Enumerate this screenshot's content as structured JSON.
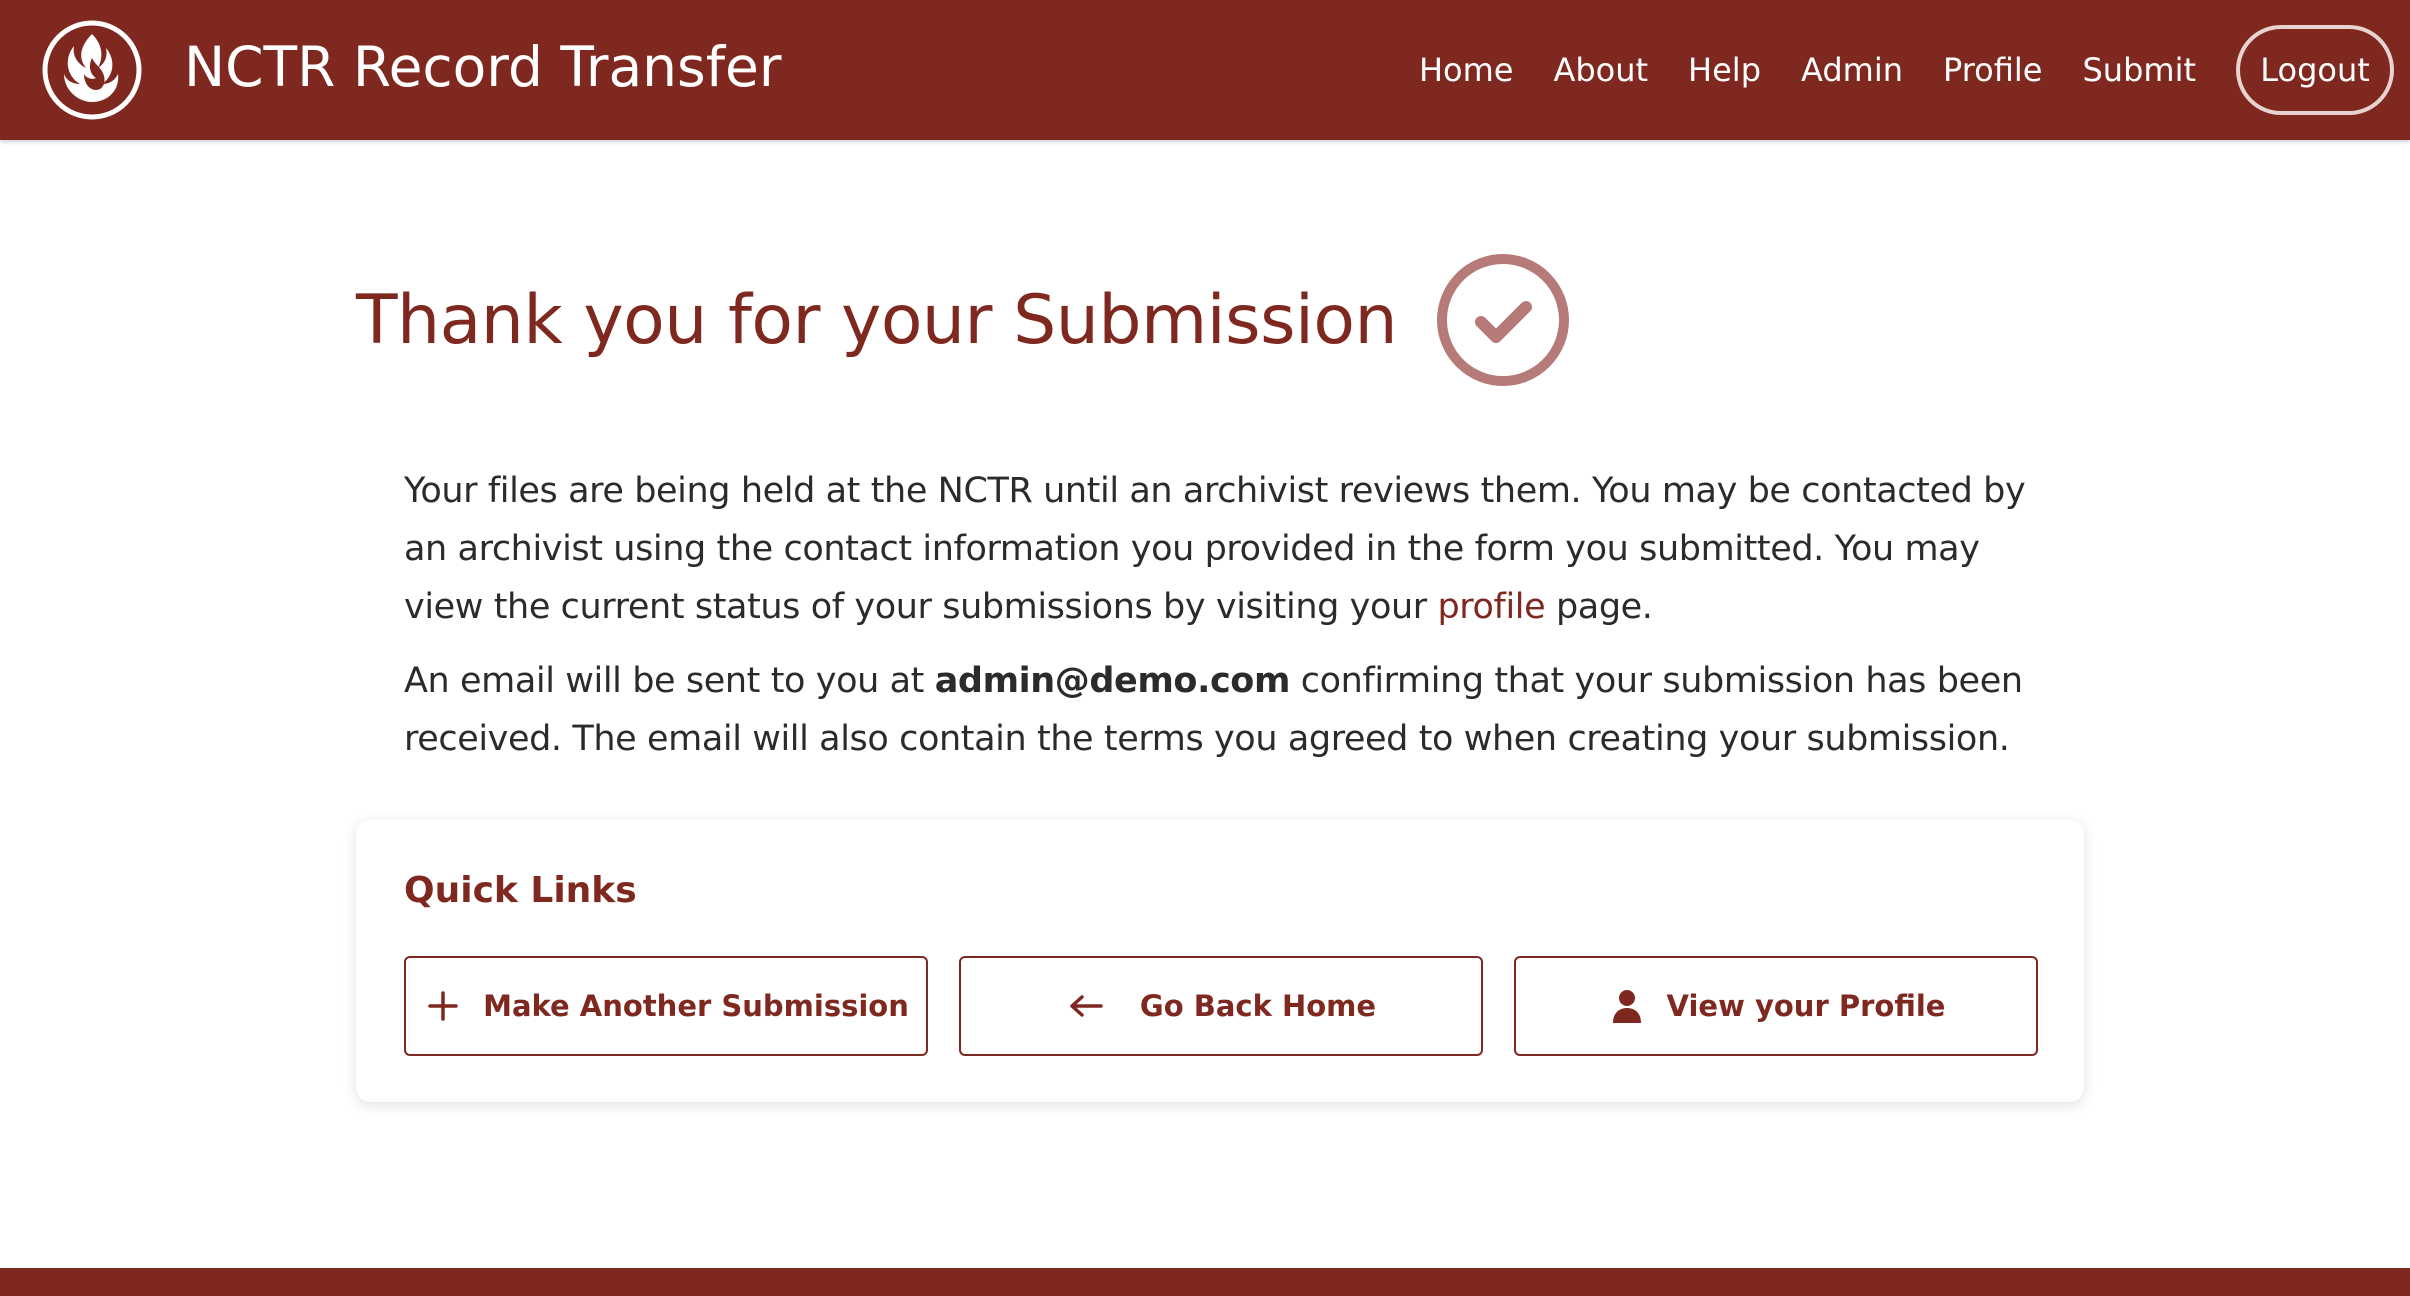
{
  "header": {
    "site_title": "NCTR Record Transfer",
    "nav": [
      "Home",
      "About",
      "Help",
      "Admin",
      "Profile",
      "Submit"
    ],
    "logout_label": "Logout",
    "logo_icon": "flame-logo-icon"
  },
  "main": {
    "title": "Thank you for your Submission",
    "status_icon": "check-circle-icon",
    "paragraph1_pre": "Your files are being held at the NCTR until an archivist reviews them. You may be contacted by an archivist using the contact information you provided in the form you submitted. You may view the current status of your submissions by visiting your ",
    "paragraph1_link": "profile",
    "paragraph1_post": " page.",
    "paragraph2_pre": "An email will be sent to you at ",
    "paragraph2_email": "admin@demo.com",
    "paragraph2_post": " confirming that your submission has been received. The email will also contain the terms you agreed to when creating your submission."
  },
  "quick_links": {
    "title": "Quick Links",
    "buttons": [
      {
        "label": "Make Another Submission",
        "icon": "plus-icon"
      },
      {
        "label": "Go Back Home",
        "icon": "arrow-left-icon"
      },
      {
        "label": "View your Profile",
        "icon": "user-icon"
      }
    ]
  },
  "colors": {
    "brand": "#7f2820",
    "check_icon": "#b67b78",
    "text": "#2b2b2b"
  }
}
